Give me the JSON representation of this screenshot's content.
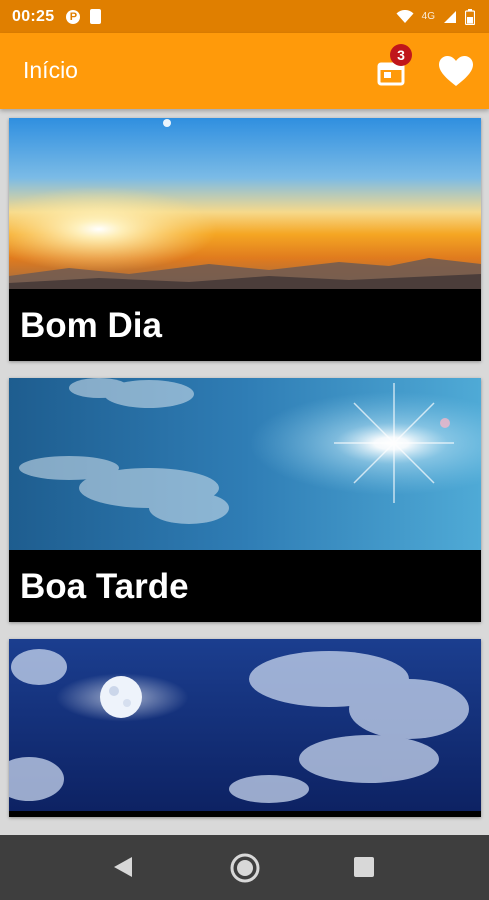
{
  "status_bar": {
    "time": "00:25",
    "notification_p": "P",
    "network_label": "4G",
    "icons": [
      "parking-app-icon",
      "phone-app-icon",
      "wifi-icon",
      "signal-icon",
      "battery-icon"
    ]
  },
  "app_bar": {
    "title": "Início",
    "notification_count": "3",
    "icons": [
      "gift-icon",
      "heart-icon"
    ],
    "colors": {
      "app_bar": "#ff9a0a",
      "status_bar": "#e07f00",
      "badge": "#c0161b"
    }
  },
  "cards": [
    {
      "caption": "Bom Dia",
      "image": "sunrise-sky-image"
    },
    {
      "caption": "Boa Tarde",
      "image": "afternoon-sun-sky-image"
    },
    {
      "caption": "",
      "image": "night-moon-sky-image"
    }
  ],
  "nav_bar": {
    "icons": [
      "back-icon",
      "home-icon",
      "recents-icon"
    ]
  }
}
